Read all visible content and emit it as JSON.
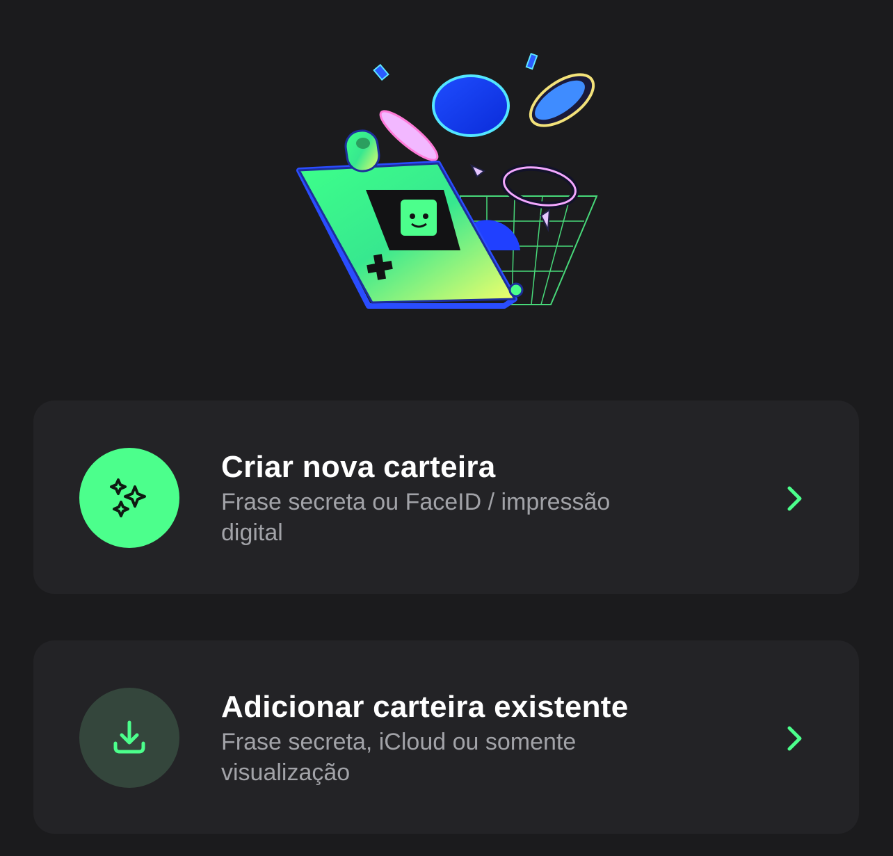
{
  "options": [
    {
      "title": "Criar nova carteira",
      "subtitle": "Frase secreta ou FaceID / impressão digital",
      "icon": "sparkles-icon"
    },
    {
      "title": "Adicionar carteira existente",
      "subtitle": "Frase secreta, iCloud ou somente visualização",
      "icon": "download-icon"
    }
  ],
  "colors": {
    "background": "#1b1b1d",
    "card": "#232326",
    "accent_green": "#4cff8c",
    "muted_green": "#34463c",
    "subtitle_text": "#a2a3a8"
  },
  "illustration": "wallet-handheld-with-coins"
}
